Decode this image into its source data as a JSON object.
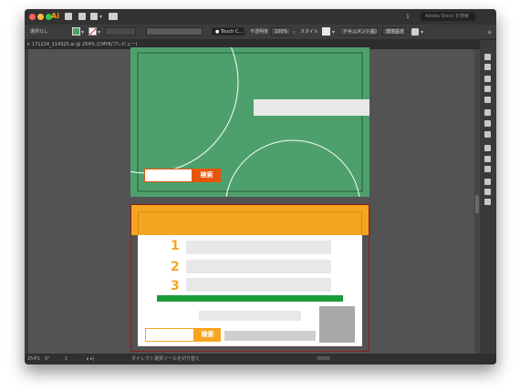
{
  "app": {
    "logo": "Ai",
    "search_placeholder": "Adobe Stock を検索",
    "workspace_number": "1"
  },
  "control_bar": {
    "selection_label": "選択なし",
    "brush_name": "Touch C...",
    "opacity_label": "不透明度",
    "opacity_value": "100%",
    "style_label": "スタイル",
    "doc_settings_button": "ドキュメント設定",
    "prefs_button": "環境設定"
  },
  "tab": {
    "close": "×",
    "title": "171224_114325.ai @ 254% (CMYK/プレビュー)"
  },
  "status": {
    "zoom": "254%",
    "angle": "0°",
    "page": "1",
    "tool_hint": "ダイレクト選択ツールを切り替え"
  },
  "artwork": {
    "top": {
      "background": "#4da06c",
      "button_label": "検索"
    },
    "bottom": {
      "band_color": "#f5a520",
      "numbers": [
        "1",
        "2",
        "3"
      ],
      "button_label": "検索",
      "green_bar_color": "#1e9b3a"
    }
  },
  "colors": {
    "accent_orange": "#f5a520",
    "button_orange": "#e8540c",
    "ui_dark": "#535353"
  }
}
